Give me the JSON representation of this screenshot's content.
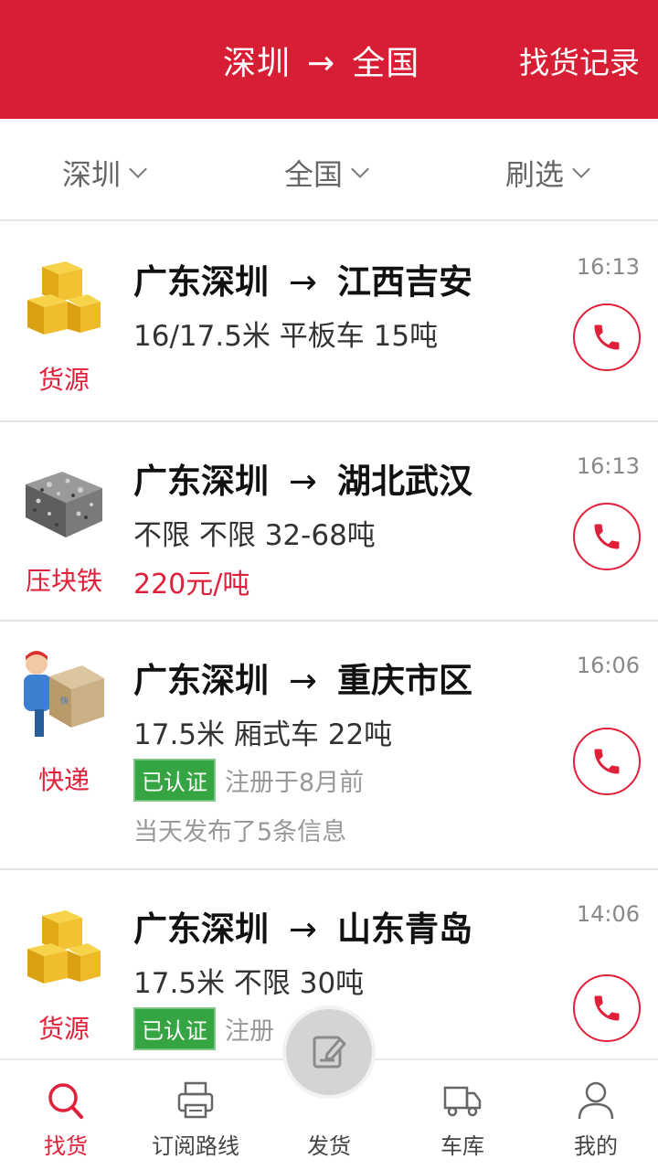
{
  "header": {
    "route_from": "深圳",
    "route_arrow": "→",
    "route_to": "全国",
    "history_label": "找货记录"
  },
  "filters": {
    "origin": "深圳",
    "destination": "全国",
    "filter": "刷选"
  },
  "listings": [
    {
      "category": "货源",
      "icon": "boxes-icon",
      "from": "广东深圳",
      "arrow": "→",
      "to": "江西吉安",
      "spec": "16/17.5米 平板车 15吨",
      "time": "16:13"
    },
    {
      "category": "压块铁",
      "icon": "scrap-iron-block-icon",
      "from": "广东深圳",
      "arrow": "→",
      "to": "湖北武汉",
      "spec": "不限 不限 32-68吨",
      "price": "220元/吨",
      "time": "16:13"
    },
    {
      "category": "快递",
      "icon": "courier-icon",
      "from": "广东深圳",
      "arrow": "→",
      "to": "重庆市区",
      "spec": "17.5米 厢式车 22吨",
      "badge": "已认证",
      "registered": "注册于8月前",
      "posted": "当天发布了5条信息",
      "time": "16:06"
    },
    {
      "category": "货源",
      "icon": "boxes-icon",
      "from": "广东深圳",
      "arrow": "→",
      "to": "山东青岛",
      "spec": "17.5米 不限 30吨",
      "badge": "已认证",
      "registered": "注册",
      "time": "14:06"
    }
  ],
  "bottom_nav": [
    {
      "label": "找货",
      "icon": "search-icon",
      "active": true
    },
    {
      "label": "订阅路线",
      "icon": "printer-icon",
      "active": false
    },
    {
      "label": "发货",
      "icon": "edit-icon",
      "active": false
    },
    {
      "label": "车库",
      "icon": "truck-icon",
      "active": false
    },
    {
      "label": "我的",
      "icon": "user-icon",
      "active": false
    }
  ],
  "colors": {
    "brand_red": "#d81e34",
    "verified_green": "#35a544"
  }
}
